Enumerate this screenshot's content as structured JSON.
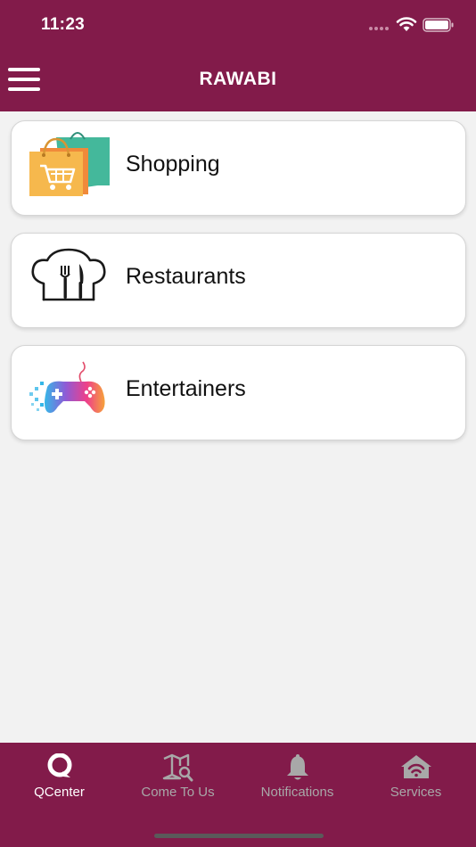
{
  "status_bar": {
    "time": "11:23"
  },
  "header": {
    "title": "RAWABI",
    "menu_icon": "hamburger-menu-icon"
  },
  "categories": [
    {
      "label": "Shopping",
      "icon": "shopping-bags-icon"
    },
    {
      "label": "Restaurants",
      "icon": "chef-hat-cutlery-icon"
    },
    {
      "label": "Entertainers",
      "icon": "gamepad-icon"
    }
  ],
  "tabs": [
    {
      "label": "QCenter",
      "icon": "qcenter-logo-icon",
      "active": true
    },
    {
      "label": "Come To Us",
      "icon": "map-search-icon",
      "active": false
    },
    {
      "label": "Notifications",
      "icon": "bell-icon",
      "active": false
    },
    {
      "label": "Services",
      "icon": "house-wifi-icon",
      "active": false
    }
  ],
  "colors": {
    "brand": "#821b4a",
    "background": "#f2f2f2",
    "tab_inactive": "#a8a8a8"
  }
}
